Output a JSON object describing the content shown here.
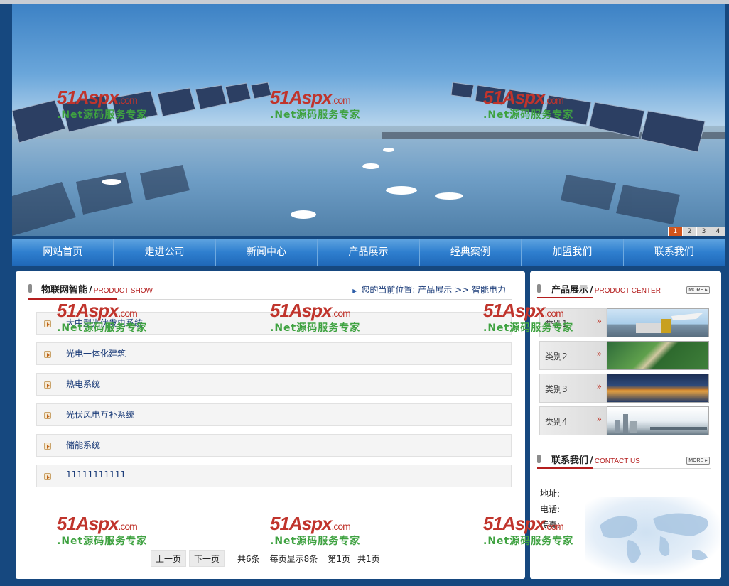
{
  "banner": {
    "slides": [
      "1",
      "2",
      "3",
      "4"
    ],
    "active_slide": "1"
  },
  "nav": {
    "items": [
      "网站首页",
      "走进公司",
      "新闻中心",
      "产品展示",
      "经典案例",
      "加盟我们",
      "联系我们"
    ]
  },
  "main": {
    "title": "物联网智能",
    "slash": "/",
    "subtitle": "PRODUCT SHOW",
    "breadcrumb": "您的当前位置: 产品展示 >> 智能电力",
    "items": [
      "大中型光伏发电系统",
      "光电一体化建筑",
      "热电系统",
      "光伏风电互补系统",
      "储能系统",
      "11111111111"
    ],
    "pager": {
      "prev": "上一页",
      "next": "下一页",
      "total": "共6条",
      "per_page": "每页显示8条",
      "page": "第1页",
      "pages": "共1页"
    }
  },
  "sidebar": {
    "product": {
      "title": "产品展示",
      "slash": "/",
      "subtitle": "PRODUCT CENTER",
      "more": "MORE",
      "categories": [
        {
          "label": "类别1",
          "arrow": "»"
        },
        {
          "label": "类别2",
          "arrow": "»"
        },
        {
          "label": "类别3",
          "arrow": "»"
        },
        {
          "label": "类别4",
          "arrow": "»"
        }
      ]
    },
    "contact": {
      "title": "联系我们",
      "slash": "/",
      "subtitle": "CONTACT US",
      "more": "MORE",
      "address_label": "地址:",
      "phone_label": "电话:",
      "fax_label": "传真:"
    }
  },
  "watermark": {
    "brand": "51Aspx",
    "domain": ".com",
    "tagline": ".Net源码服务专家"
  },
  "colors": {
    "page_bg": "#16487f",
    "nav_blue": "#2f7fcf",
    "accent_red": "#b41e1e",
    "watermark_red": "#c0342c",
    "watermark_green": "#3fa241"
  }
}
